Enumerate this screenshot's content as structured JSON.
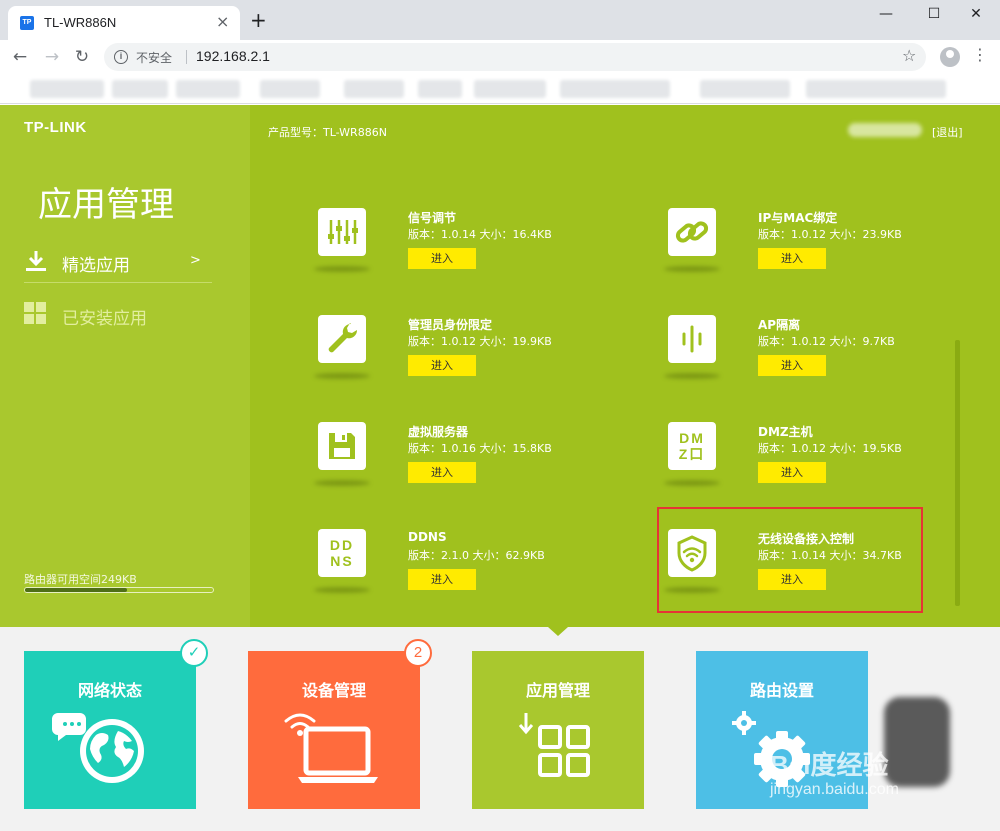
{
  "browser": {
    "tab_title": "TL-WR886N",
    "favicon_text": "TP",
    "close_glyph": "×",
    "new_tab_glyph": "+",
    "minimize_glyph": "—",
    "maximize_glyph": "☐",
    "window_close_glyph": "✕",
    "back_glyph": "←",
    "forward_glyph": "→",
    "reload_glyph": "↻",
    "security_text": "不安全",
    "url": "192.168.2.1",
    "star_glyph": "☆",
    "menu_glyph": "⋮"
  },
  "router": {
    "logo": "TP-LINK",
    "page_heading": "应用管理",
    "menu": [
      {
        "label": "精选应用",
        "arrow": ">",
        "selected": true
      },
      {
        "label": "已安装应用",
        "selected": false
      }
    ],
    "storage_label": "路由器可用空间249KB",
    "storage_fraction": 0.54,
    "model_label": "产品型号：TL-WR886N",
    "logout": "[退出]",
    "enter_label": "进入",
    "apps": [
      {
        "name": "信号调节",
        "meta": "版本：1.0.14 大小：16.4KB",
        "icon": "sliders-icon"
      },
      {
        "name": "IP与MAC绑定",
        "meta": "版本：1.0.12 大小：23.9KB",
        "icon": "link-icon"
      },
      {
        "name": "管理员身份限定",
        "meta": "版本：1.0.12 大小：19.9KB",
        "icon": "wrench-icon"
      },
      {
        "name": "AP隔离",
        "meta": "版本：1.0.12 大小：9.7KB",
        "icon": "ap-isolation-icon"
      },
      {
        "name": "虚拟服务器",
        "meta": "版本：1.0.16 大小：15.8KB",
        "icon": "floppy-icon"
      },
      {
        "name": "DMZ主机",
        "meta": "版本：1.0.12 大小：19.5KB",
        "icon": "dmz-icon",
        "icon_text": [
          "DM",
          "Z口"
        ]
      },
      {
        "name": "DDNS",
        "meta": "版本：2.1.0 大小：62.9KB",
        "icon": "ddns-icon",
        "icon_text": [
          "DD",
          "NS"
        ]
      },
      {
        "name": "无线设备接入控制",
        "meta": "版本：1.0.14 大小：34.7KB",
        "icon": "wifi-shield-icon",
        "highlighted": true
      }
    ],
    "tiles": [
      {
        "title": "网络状态",
        "color": "#1fcfb8",
        "badge": "✓"
      },
      {
        "title": "设备管理",
        "color": "#ff6b3d",
        "badge": "2"
      },
      {
        "title": "应用管理",
        "color": "#a9c82e"
      },
      {
        "title": "路由设置",
        "color": "#4dbfe6"
      }
    ],
    "watermark": {
      "brand": "Bai度经验",
      "site": "jingyan.baidu.com"
    }
  }
}
